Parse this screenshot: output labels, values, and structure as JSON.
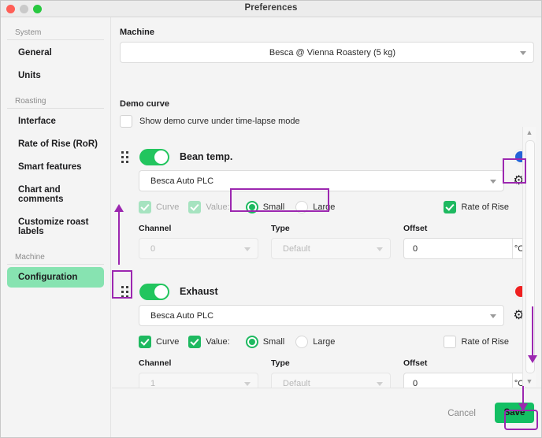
{
  "window": {
    "title": "Preferences",
    "controls": {
      "close": "close-button",
      "minimize": "minimize-button",
      "maximize": "maximize-button"
    }
  },
  "sidebar": {
    "groups": [
      {
        "label": "System",
        "items": [
          {
            "label": "General",
            "selected": false
          },
          {
            "label": "Units",
            "selected": false
          }
        ]
      },
      {
        "label": "Roasting",
        "items": [
          {
            "label": "Interface",
            "selected": false
          },
          {
            "label": "Rate of Rise (RoR)",
            "selected": false
          },
          {
            "label": "Smart features",
            "selected": false
          },
          {
            "label": "Chart and comments",
            "selected": false
          },
          {
            "label": "Customize roast labels",
            "selected": false
          }
        ]
      },
      {
        "label": "Machine",
        "items": [
          {
            "label": "Configuration",
            "selected": true
          }
        ]
      }
    ]
  },
  "main": {
    "machine": {
      "label": "Machine",
      "value": "Besca  @ Vienna Roastery (5 kg)"
    },
    "demo_curve": {
      "label": "Demo curve",
      "checkbox_label": "Show demo curve under time-lapse mode",
      "checked": false
    },
    "channels": [
      {
        "name": "Bean temp.",
        "enabled": true,
        "color": "#2563d8",
        "device": "Besca Auto PLC",
        "gear_icon": "gear-icon",
        "curve": {
          "label": "Curve",
          "checked": true,
          "disabled": true
        },
        "value": {
          "label": "Value:",
          "checked": true,
          "disabled": true
        },
        "size": {
          "small_label": "Small",
          "large_label": "Large",
          "selected": "Small"
        },
        "rate_of_rise": {
          "label": "Rate of Rise",
          "checked": true,
          "disabled": false
        },
        "channel": {
          "label": "Channel",
          "value": "0",
          "disabled": true
        },
        "type": {
          "label": "Type",
          "value": "Default",
          "disabled": true
        },
        "offset": {
          "label": "Offset",
          "value": "0",
          "unit": "°C"
        }
      },
      {
        "name": "Exhaust",
        "enabled": true,
        "color": "#ef2020",
        "device": "Besca Auto PLC",
        "gear_icon": "gear-icon",
        "curve": {
          "label": "Curve",
          "checked": true,
          "disabled": false
        },
        "value": {
          "label": "Value:",
          "checked": true,
          "disabled": false
        },
        "size": {
          "small_label": "Small",
          "large_label": "Large",
          "selected": "Small"
        },
        "rate_of_rise": {
          "label": "Rate of Rise",
          "checked": false,
          "disabled": false
        },
        "channel": {
          "label": "Channel",
          "value": "1",
          "disabled": true
        },
        "type": {
          "label": "Type",
          "value": "Default",
          "disabled": true
        },
        "offset": {
          "label": "Offset",
          "value": "0",
          "unit": "°C"
        }
      }
    ],
    "scrollbar": {
      "up": "▲",
      "down": "▼"
    }
  },
  "footer": {
    "cancel_label": "Cancel",
    "save_label": "Save"
  },
  "annotations": {
    "highlight_color": "#9c27b0",
    "count": 4
  }
}
